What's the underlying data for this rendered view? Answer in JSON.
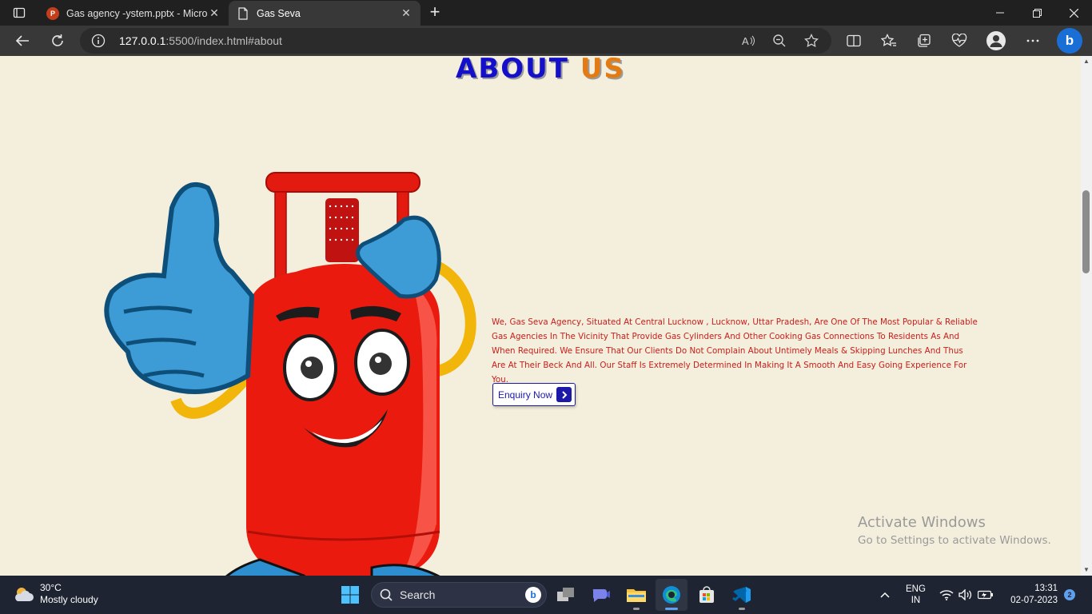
{
  "browser": {
    "tabs": [
      {
        "title": "Gas agency -ystem.pptx - Micros",
        "icon": "powerpoint-icon",
        "active": false
      },
      {
        "title": "Gas Seva",
        "icon": "page-icon",
        "active": true
      }
    ],
    "address": {
      "host": "127.0.0.1",
      "rest": ":5500/index.html#about"
    }
  },
  "page": {
    "heading_part1": "ABOUT",
    "heading_part2": "US",
    "about_text": "We, Gas Seva Agency, Situated At Central Lucknow , Lucknow, Uttar Pradesh, Are One Of The Most Popular & Reliable Gas Agencies In The Vicinity That Provide Gas Cylinders And Other Cooking Gas Connections To Residents As And When Required. We Ensure That Our Clients Do Not Complain About Untimely Meals & Skipping Lunches And Thus Are At Their Beck And All. Our Staff Is Extremely Determined In Making It A Smooth And Easy Going Experience For You.",
    "enquiry_label": "Enquiry Now",
    "colors": {
      "heading_blue": "#1410c9",
      "heading_orange": "#e37b12",
      "text_red": "#c8201e",
      "background": "#f4efdc"
    }
  },
  "watermark": {
    "line1": "Activate Windows",
    "line2": "Go to Settings to activate Windows."
  },
  "taskbar": {
    "weather_temp": "30°C",
    "weather_desc": "Mostly cloudy",
    "search_label": "Search",
    "lang_line1": "ENG",
    "lang_line2": "IN",
    "time": "13:31",
    "date": "02-07-2023",
    "notifications": "2"
  }
}
